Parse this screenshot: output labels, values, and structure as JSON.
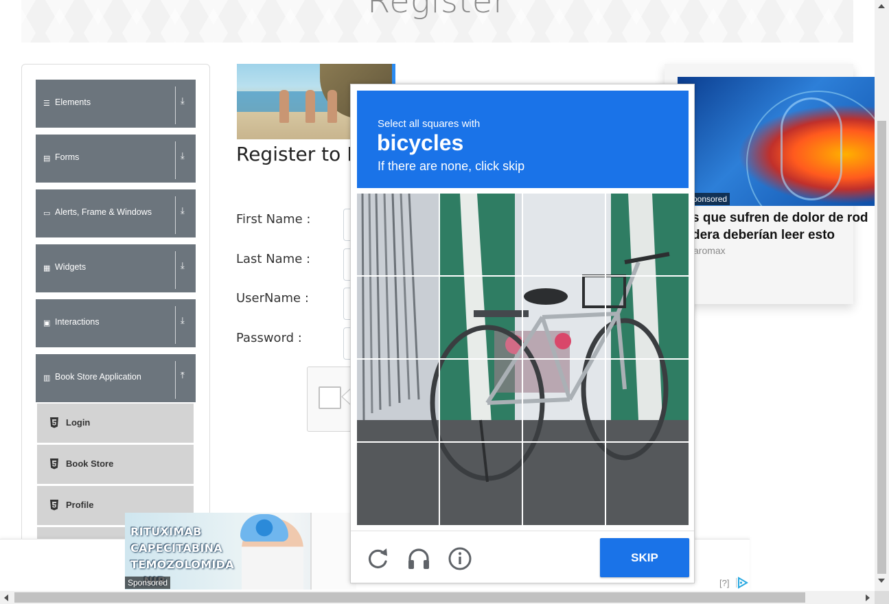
{
  "header": {
    "title": "Register"
  },
  "sidebar": {
    "groups": [
      {
        "label": "Elements",
        "icon": "hamburger-icon"
      },
      {
        "label": "Forms",
        "icon": "form-icon"
      },
      {
        "label": "Alerts, Frame & Windows",
        "icon": "window-icon"
      },
      {
        "label": "Widgets",
        "icon": "grid-icon"
      },
      {
        "label": "Interactions",
        "icon": "interaction-icon"
      },
      {
        "label": "Book Store Application",
        "icon": "books-icon"
      }
    ],
    "book_store_items": [
      {
        "label": "Login",
        "icon": "html5-icon"
      },
      {
        "label": "Book Store",
        "icon": "html5-icon"
      },
      {
        "label": "Profile",
        "icon": "html5-icon"
      }
    ]
  },
  "main": {
    "heading": "Register to B",
    "fields": [
      {
        "label": "First Name :"
      },
      {
        "label": "Last Name :"
      },
      {
        "label": "UserName :"
      },
      {
        "label": "Password :"
      }
    ]
  },
  "right_ad": {
    "sponsored": "Sponsored",
    "title_line1": "s que sufren de dolor de rod",
    "title_line2": "dera deberían leer esto",
    "source": "aromax"
  },
  "bottom_ad": {
    "lines": [
      "RITUXIMAB",
      "CAPECITABINA",
      "TEMOZOLOMIDA",
      "...NIB"
    ],
    "sponsored": "Sponsored",
    "adchoices": "[?]"
  },
  "captcha": {
    "prompt": "Select all squares with",
    "target": "bicycles",
    "hint": "If there are none, click skip",
    "skip_label": "SKIP",
    "grid_rows": 4,
    "grid_cols": 4,
    "accent": "#1a73e8"
  }
}
